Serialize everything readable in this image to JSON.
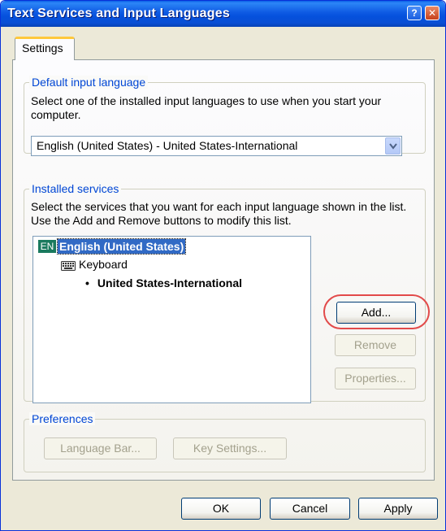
{
  "window": {
    "title": "Text Services and Input Languages",
    "help_label": "?",
    "close_label": "✕",
    "titlebar_color": "#0A4FD4"
  },
  "tabs": [
    {
      "label": "Settings",
      "selected": true
    }
  ],
  "default_input": {
    "legend": "Default input language",
    "description": "Select one of the installed input languages to use when you start your computer.",
    "selected_value": "English (United States) - United States-International",
    "dropdown_icon": "chevron-down-icon"
  },
  "installed_services": {
    "legend": "Installed services",
    "description": "Select the services that you want for each input language shown in the list. Use the Add and Remove buttons to modify this list.",
    "language": {
      "badge": "EN",
      "name": "English (United States)"
    },
    "category": {
      "icon": "keyboard-icon",
      "label": "Keyboard"
    },
    "layout": {
      "bullet": "•",
      "name": "United States-International"
    },
    "buttons": {
      "add": "Add...",
      "remove": "Remove",
      "properties": "Properties..."
    }
  },
  "preferences": {
    "legend": "Preferences",
    "language_bar": "Language Bar...",
    "key_settings": "Key Settings..."
  },
  "footer": {
    "ok": "OK",
    "cancel": "Cancel",
    "apply": "Apply"
  },
  "annotation": {
    "highlight_color": "#E24A4A"
  }
}
